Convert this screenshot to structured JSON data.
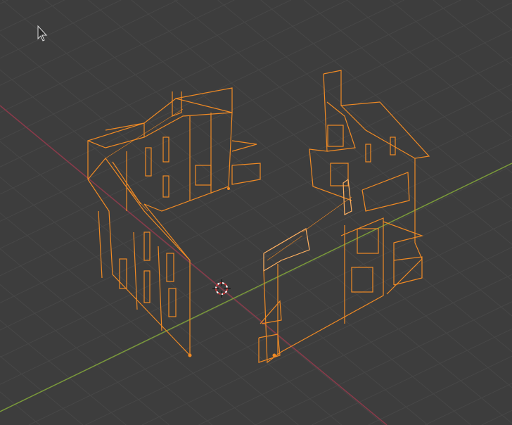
{
  "viewport": {
    "background_color": "#3d3d3d",
    "grid_color": "#474747",
    "x_axis_color": "#8a3a4a",
    "y_axis_color": "#7a9a3a",
    "selection_color": "#f08a24",
    "active_selection_color": "#ffb060"
  },
  "icons": {
    "cursor": "mouse-pointer-icon",
    "origin": "3d-cursor-icon"
  }
}
